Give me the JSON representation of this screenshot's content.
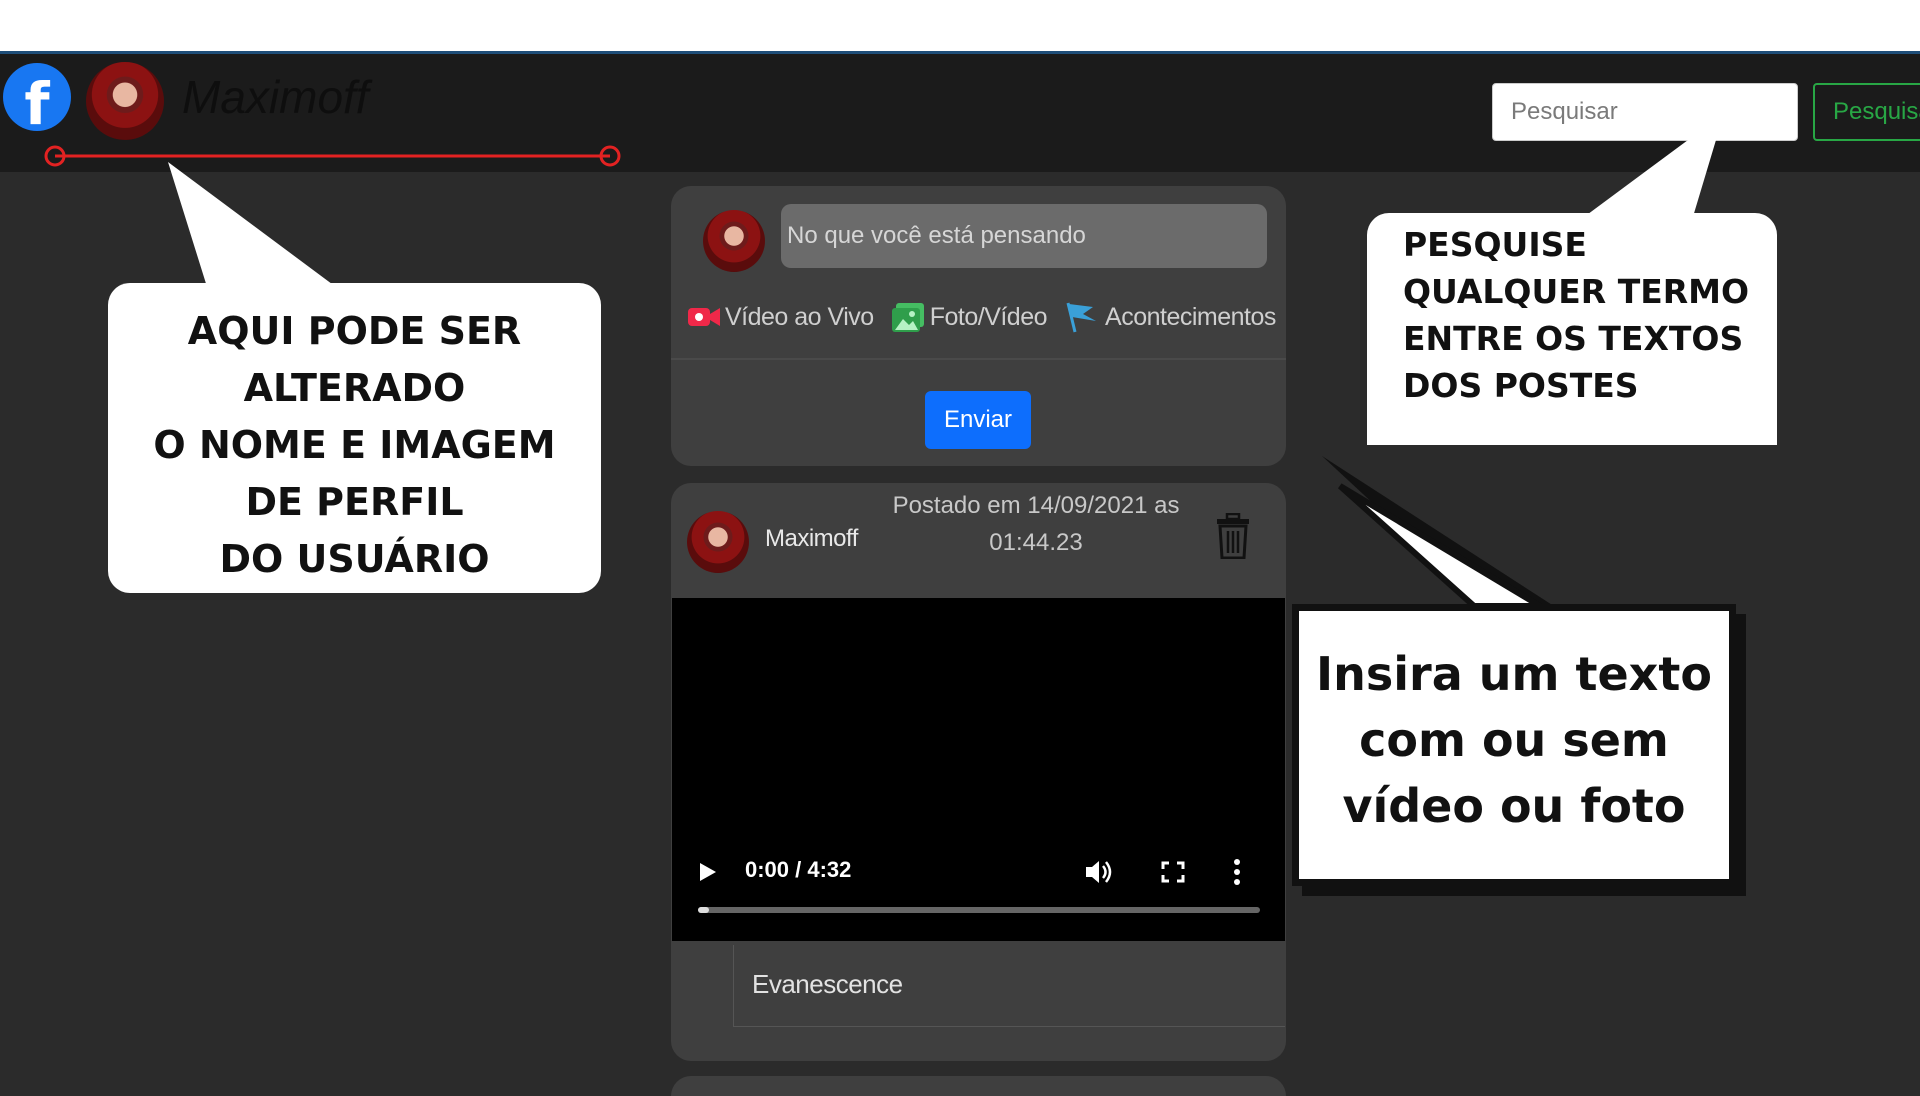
{
  "navbar": {
    "user_name": "Maximoff",
    "search_placeholder": "Pesquisar",
    "search_button_label": "Pesquisar"
  },
  "compose": {
    "placeholder": "No que você está pensando",
    "actions": [
      {
        "label": "Vídeo ao Vivo",
        "icon": "live-video-icon"
      },
      {
        "label": "Foto/Vídeo",
        "icon": "photo-icon"
      },
      {
        "label": "Acontecimentos",
        "icon": "flag-icon"
      }
    ],
    "send_label": "Enviar"
  },
  "post": {
    "author": "Maximoff",
    "date_line1": "Postado em 14/09/2021 as",
    "date_line2": "01:44.23",
    "video": {
      "time": "0:00 / 4:32",
      "progress": 0.02
    },
    "text": "Evanescence"
  },
  "annotations": {
    "profile_note": [
      "AQUI PODE SER",
      "ALTERADO",
      "O NOME E IMAGEM",
      "DE PERFIL",
      "DO USUÁRIO"
    ],
    "search_note": [
      "PESQUISE",
      "QUALQUER TERMO",
      "ENTRE OS TEXTOS",
      "DOS POSTES"
    ],
    "post_note": [
      "Insira um texto",
      "com ou sem",
      "vídeo ou foto"
    ]
  },
  "colors": {
    "background": "#2b2b2b",
    "navbar": "#1b1b1b",
    "card": "#3f3f3f",
    "facebook_blue": "#1877f2",
    "send_blue": "#0d6efd",
    "search_green": "#28a745",
    "annotation_red": "#e32222"
  }
}
